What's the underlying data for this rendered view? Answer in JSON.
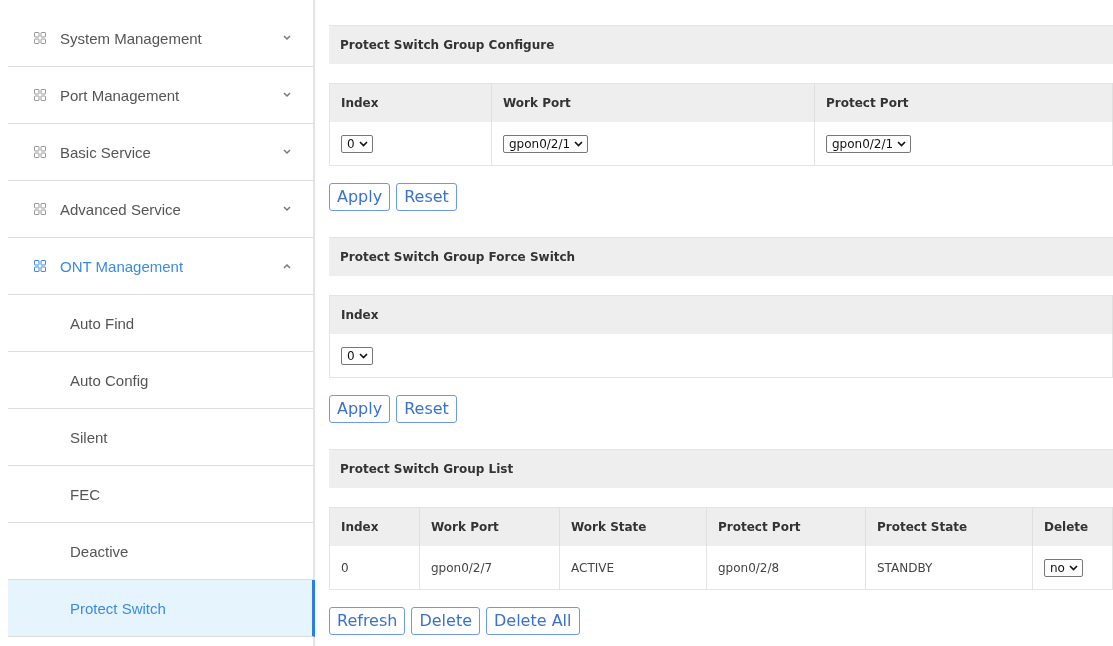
{
  "sidebar": {
    "items": [
      {
        "label": "System Management",
        "expanded": false
      },
      {
        "label": "Port Management",
        "expanded": false
      },
      {
        "label": "Basic Service",
        "expanded": false
      },
      {
        "label": "Advanced Service",
        "expanded": false
      },
      {
        "label": "ONT Management",
        "expanded": true,
        "children": [
          {
            "label": "Auto Find",
            "selected": false
          },
          {
            "label": "Auto Config",
            "selected": false
          },
          {
            "label": "Silent",
            "selected": false
          },
          {
            "label": "FEC",
            "selected": false
          },
          {
            "label": "Deactive",
            "selected": false
          },
          {
            "label": "Protect Switch",
            "selected": true
          }
        ]
      }
    ]
  },
  "sections": [
    {
      "title": "Protect Switch Group Configure",
      "columns": [
        "Index",
        "Work Port",
        "Protect Port"
      ],
      "rows": [
        [
          {
            "kind": "select",
            "value": "0"
          },
          {
            "kind": "select",
            "value": "gpon0/2/1"
          },
          {
            "kind": "select",
            "value": "gpon0/2/1"
          }
        ]
      ],
      "buttons": [
        "Apply",
        "Reset"
      ]
    },
    {
      "title": "Protect Switch Group Force Switch",
      "columns": [
        "Index"
      ],
      "rows": [
        [
          {
            "kind": "select",
            "value": "0"
          }
        ]
      ],
      "buttons": [
        "Apply",
        "Reset"
      ]
    },
    {
      "title": "Protect Switch Group List",
      "columns": [
        "Index",
        "Work Port",
        "Work State",
        "Protect Port",
        "Protect State",
        "Delete"
      ],
      "rows": [
        [
          {
            "kind": "text",
            "value": "0"
          },
          {
            "kind": "text",
            "value": "gpon0/2/7"
          },
          {
            "kind": "text",
            "value": "ACTIVE"
          },
          {
            "kind": "text",
            "value": "gpon0/2/8"
          },
          {
            "kind": "text",
            "value": "STANDBY"
          },
          {
            "kind": "select",
            "value": "no"
          }
        ]
      ],
      "buttons": [
        "Refresh",
        "Delete",
        "Delete All"
      ]
    }
  ]
}
